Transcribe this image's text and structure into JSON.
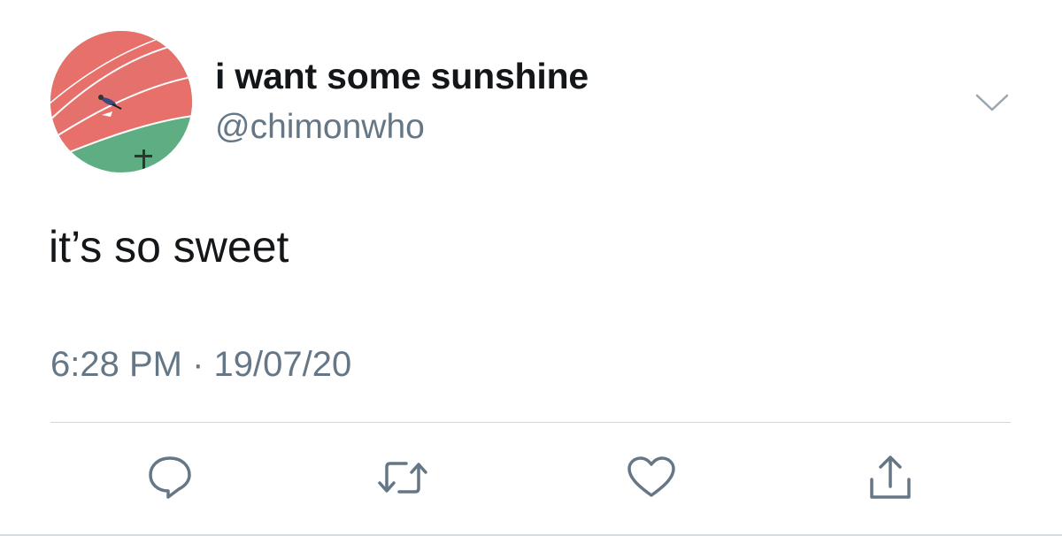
{
  "tweet": {
    "display_name": "i want some sunshine",
    "handle": "@chimonwho",
    "text": "it’s so sweet",
    "time": "6:28 PM",
    "separator": " · ",
    "date": "19/07/20"
  },
  "icons": {
    "menu": "chevron-down-icon",
    "reply": "reply-icon",
    "retweet": "retweet-icon",
    "like": "heart-icon",
    "share": "share-icon"
  },
  "colors": {
    "text_primary": "#14171a",
    "text_secondary": "#657786",
    "icon": "#657786",
    "avatar_track": "#e8706b",
    "avatar_field": "#5fae83"
  }
}
